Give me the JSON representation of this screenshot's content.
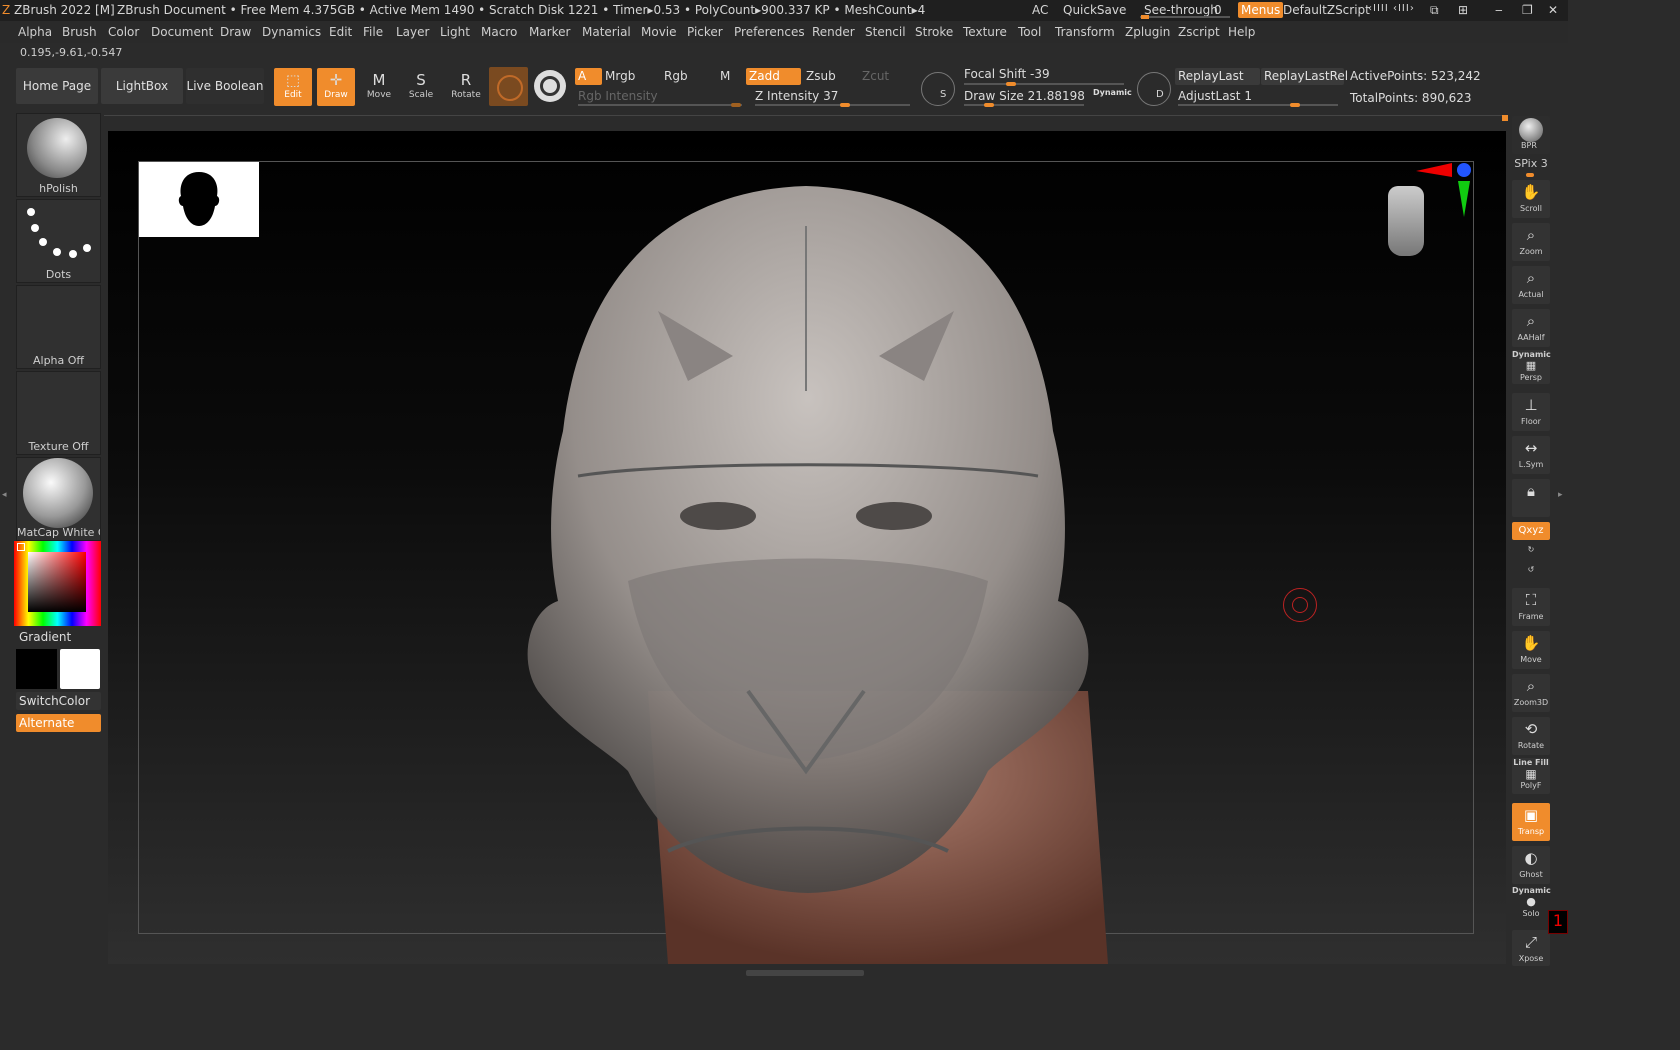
{
  "titlebar": {
    "app": "ZBrush 2022 [M]",
    "doc": "ZBrush Document",
    "stats": ". • Free Mem 4.375GB • Active Mem 1490 • Scratch Disk 1221 • Timer▸0.53 • PolyCount▸900.337 KP • MeshCount▸4",
    "ac": "AC",
    "quicksave": "QuickSave",
    "see_through": "See-through",
    "see_through_value": "0",
    "menus": "Menus",
    "default_zscript": "DefaultZScript"
  },
  "menu": [
    "Alpha",
    "Brush",
    "Color",
    "Document",
    "Draw",
    "Dynamics",
    "Edit",
    "File",
    "Layer",
    "Light",
    "Macro",
    "Marker",
    "Material",
    "Movie",
    "Picker",
    "Preferences",
    "Render",
    "Stencil",
    "Stroke",
    "Texture",
    "Tool",
    "Transform",
    "Zplugin",
    "Zscript",
    "Help"
  ],
  "coords": "0.195,-9.61,-0.547",
  "toolbar": {
    "home_page": "Home Page",
    "lightbox": "LightBox",
    "live_boolean": "Live Boolean",
    "edit": "Edit",
    "draw": "Draw",
    "move": "Move",
    "scale": "Scale",
    "rotate": "Rotate",
    "a": "A",
    "mrgb": "Mrgb",
    "rgb": "Rgb",
    "m": "M",
    "zadd": "Zadd",
    "zsub": "Zsub",
    "zcut": "Zcut",
    "rgb_intensity": "Rgb Intensity",
    "z_intensity": "Z Intensity 37",
    "focal_shift": "Focal Shift -39",
    "draw_size": "Draw Size 21.88198",
    "dynamic": "Dynamic",
    "replay_last": "ReplayLast",
    "replay_last_rel": "ReplayLastRel",
    "adjust_last": "AdjustLast 1",
    "active_points": "ActivePoints: 523,242",
    "total_points": "TotalPoints: 890,623",
    "s": "S",
    "d": "D"
  },
  "left_shelf": {
    "brush": "hPolish",
    "stroke": "Dots",
    "alpha": "Alpha Off",
    "texture": "Texture Off",
    "material": "MatCap White C",
    "gradient": "Gradient",
    "switch_color": "SwitchColor",
    "alternate": "Alternate"
  },
  "right_shelf": {
    "bpr": "BPR",
    "spix": "SPix 3",
    "scroll": "Scroll",
    "zoom": "Zoom",
    "actual": "Actual",
    "aahalf": "AAHalf",
    "dynamic": "Dynamic",
    "persp": "Persp",
    "floor": "Floor",
    "lsym": "L.Sym",
    "xyz": "Qxyz",
    "frame": "Frame",
    "move": "Move",
    "zoom3d": "Zoom3D",
    "rotate": "Rotate",
    "line_fill": "Line Fill",
    "polyf": "PolyF",
    "transp": "Transp",
    "ghost": "Ghost",
    "dynamic2": "Dynamic",
    "solo": "Solo",
    "xpose": "Xpose",
    "badge": "1"
  },
  "colors": {
    "accent": "#f08c2c",
    "bg": "#2b2b2b",
    "panel": "#3a3a3a"
  }
}
